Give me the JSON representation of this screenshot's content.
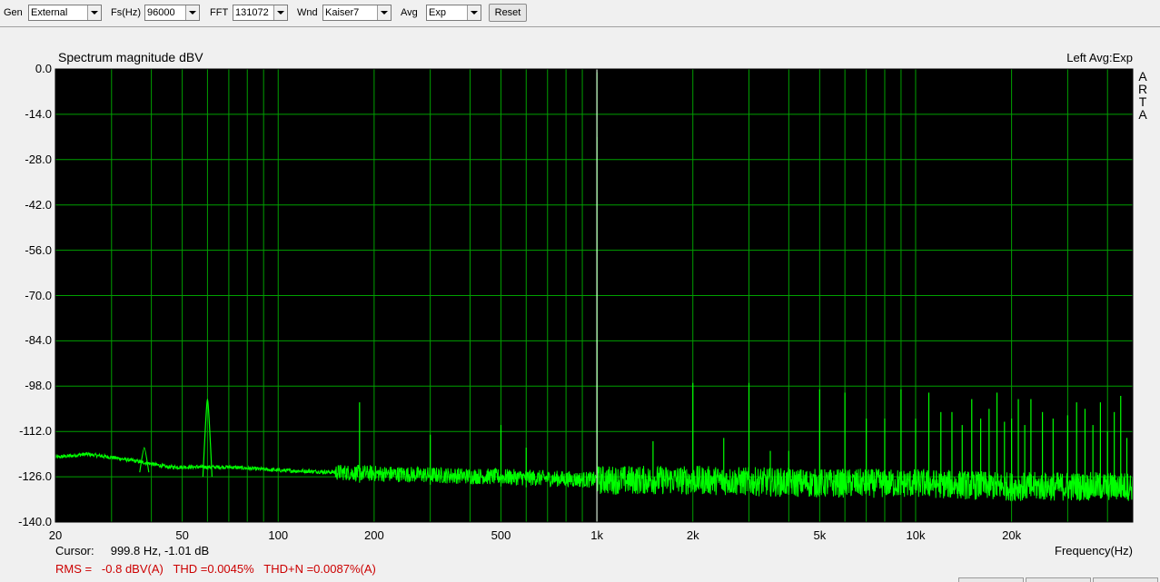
{
  "toolbar": {
    "gen_label": "Gen",
    "gen_value": "External",
    "fs_label": "Fs(Hz)",
    "fs_value": "96000",
    "fft_label": "FFT",
    "fft_value": "131072",
    "wnd_label": "Wnd",
    "wnd_value": "Kaiser7",
    "avg_label": "Avg",
    "avg_value": "Exp",
    "reset_label": "Reset"
  },
  "chart_header": {
    "title": "Spectrum magnitude dBV",
    "channel": "Left  Avg:Exp",
    "logo": "ARTA"
  },
  "footer": {
    "cursor_label": "Cursor:",
    "cursor_value": "999.8 Hz, -1.01 dB",
    "measurement": "RMS =   -0.8 dBV(A)   THD =0.0045%   THD+N =0.0087%(A)"
  },
  "colors": {
    "background": "#000000",
    "grid": "#00a000",
    "trace": "#00ff00",
    "cursor": "#ffffff",
    "measurement_text": "#cc0000"
  },
  "chart_data": {
    "type": "line",
    "title": "Spectrum magnitude dBV",
    "xlabel": "Frequency(Hz)",
    "ylabel": "",
    "xscale": "log",
    "xlim": [
      20,
      48000
    ],
    "ylim": [
      -140,
      0
    ],
    "grid": true,
    "ytick_labels": [
      "0.0",
      "-14.0",
      "-28.0",
      "-42.0",
      "-56.0",
      "-70.0",
      "-84.0",
      "-98.0",
      "-112.0",
      "-126.0",
      "-140.0"
    ],
    "ytick_values": [
      0,
      -14,
      -28,
      -42,
      -56,
      -70,
      -84,
      -98,
      -112,
      -126,
      -140
    ],
    "xtick_labels": [
      "20",
      "50",
      "100",
      "200",
      "500",
      "1k",
      "2k",
      "5k",
      "10k",
      "20k"
    ],
    "xtick_values": [
      20,
      50,
      100,
      200,
      500,
      1000,
      2000,
      5000,
      10000,
      20000
    ],
    "cursor_frequency": 999.8,
    "noise_floor": [
      [
        20,
        -120
      ],
      [
        25,
        -119
      ],
      [
        30,
        -120
      ],
      [
        35,
        -121
      ],
      [
        40,
        -122
      ],
      [
        45,
        -123
      ],
      [
        50,
        -123
      ],
      [
        70,
        -123
      ],
      [
        100,
        -124
      ],
      [
        200,
        -125
      ],
      [
        500,
        -126
      ],
      [
        1000,
        -127
      ],
      [
        2000,
        -127
      ],
      [
        5000,
        -128
      ],
      [
        10000,
        -128
      ],
      [
        20000,
        -129
      ],
      [
        48000,
        -129
      ]
    ],
    "peaks": [
      {
        "x": 38,
        "y": -117
      },
      {
        "x": 60,
        "y": -102
      },
      {
        "x": 180,
        "y": -103
      },
      {
        "x": 300,
        "y": -113
      },
      {
        "x": 500,
        "y": -110
      },
      {
        "x": 600,
        "y": -117
      },
      {
        "x": 1000,
        "y": -1
      },
      {
        "x": 1000,
        "y": -21
      },
      {
        "x": 1000,
        "y": -84
      },
      {
        "x": 1500,
        "y": -115
      },
      {
        "x": 2000,
        "y": -97
      },
      {
        "x": 2500,
        "y": -114
      },
      {
        "x": 3000,
        "y": -97
      },
      {
        "x": 3500,
        "y": -118
      },
      {
        "x": 4000,
        "y": -118
      },
      {
        "x": 5000,
        "y": -99
      },
      {
        "x": 6000,
        "y": -100
      },
      {
        "x": 7000,
        "y": -108
      },
      {
        "x": 8000,
        "y": -108
      },
      {
        "x": 9000,
        "y": -99
      },
      {
        "x": 10000,
        "y": -108
      },
      {
        "x": 11000,
        "y": -100
      },
      {
        "x": 12000,
        "y": -106
      },
      {
        "x": 13000,
        "y": -106
      },
      {
        "x": 14000,
        "y": -110
      },
      {
        "x": 15000,
        "y": -102
      },
      {
        "x": 16000,
        "y": -108
      },
      {
        "x": 17000,
        "y": -105
      },
      {
        "x": 18000,
        "y": -100
      },
      {
        "x": 19000,
        "y": -109
      },
      {
        "x": 20000,
        "y": -108
      },
      {
        "x": 21000,
        "y": -102
      },
      {
        "x": 22000,
        "y": -110
      },
      {
        "x": 23000,
        "y": -102
      },
      {
        "x": 25000,
        "y": -106
      },
      {
        "x": 27000,
        "y": -108
      },
      {
        "x": 30000,
        "y": -107
      },
      {
        "x": 32000,
        "y": -103
      },
      {
        "x": 34000,
        "y": -105
      },
      {
        "x": 36000,
        "y": -110
      },
      {
        "x": 38000,
        "y": -103
      },
      {
        "x": 40000,
        "y": -112
      },
      {
        "x": 42000,
        "y": -106
      },
      {
        "x": 44000,
        "y": -101
      },
      {
        "x": 46000,
        "y": -114
      }
    ]
  }
}
